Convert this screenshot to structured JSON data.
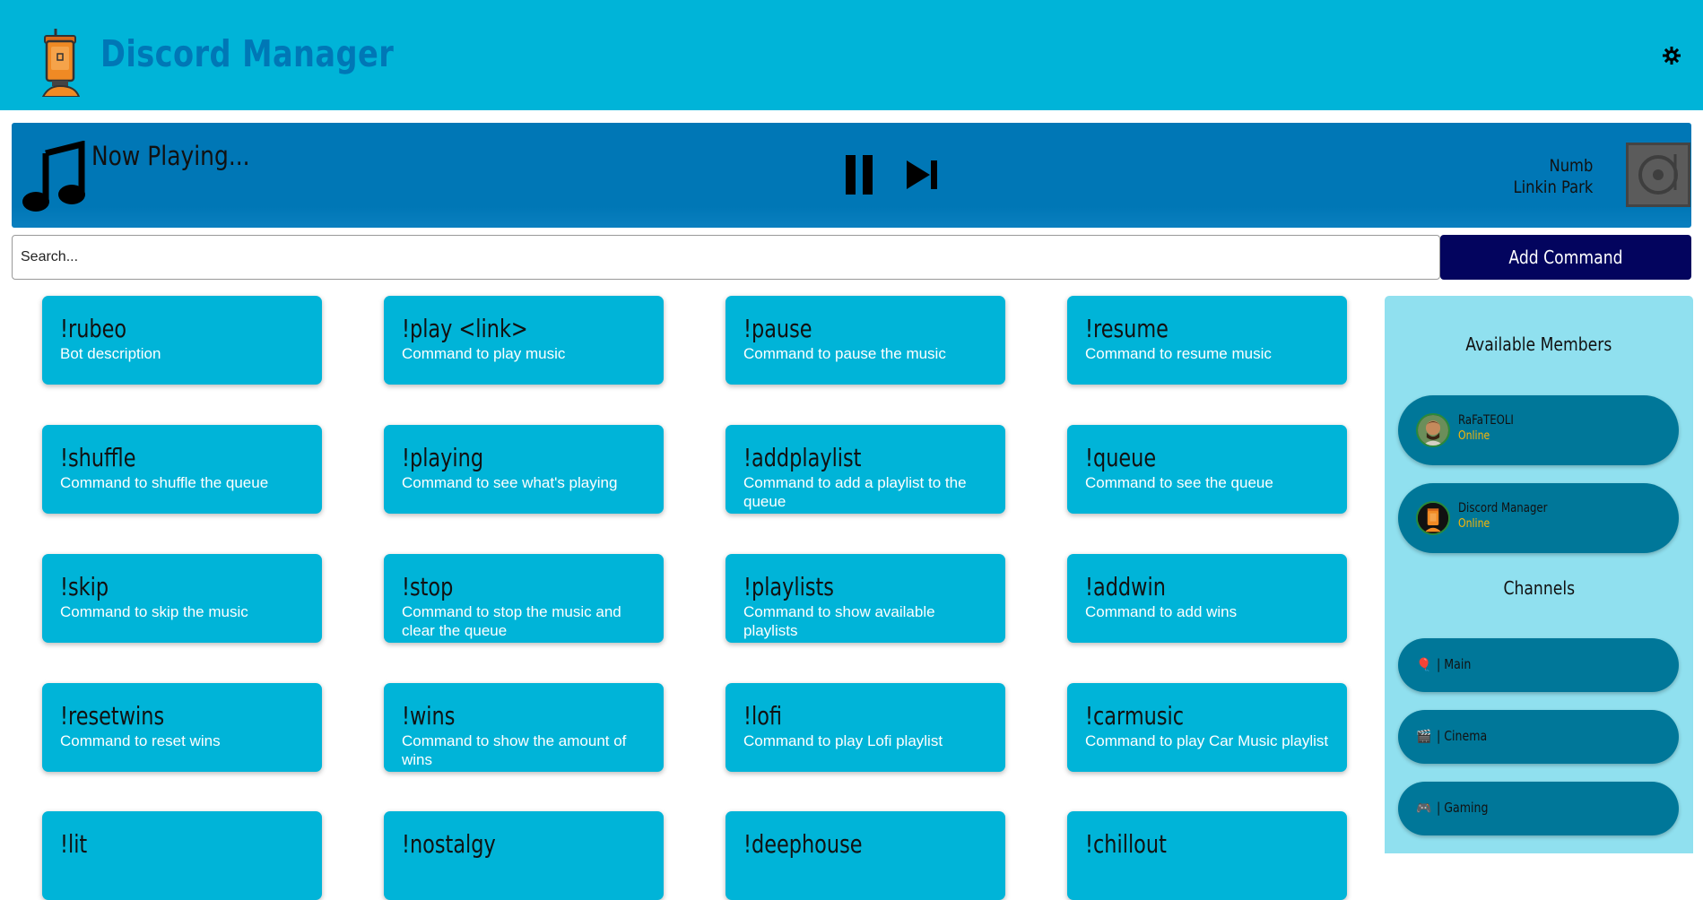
{
  "header": {
    "title": "Discord Manager",
    "logo_icon": "robot-logo-icon",
    "theme_icon": "gear-icon"
  },
  "player": {
    "status": "Now Playing...",
    "track": "Numb",
    "artist": "Linkin Park"
  },
  "search": {
    "placeholder": "Search..."
  },
  "toolbar": {
    "add_label": "Add Command"
  },
  "commands": [
    {
      "name": "!rubeo",
      "desc": "Bot description"
    },
    {
      "name": "!play <link>",
      "desc": "Command to play music"
    },
    {
      "name": "!pause",
      "desc": "Command to pause the music"
    },
    {
      "name": "!resume",
      "desc": "Command to resume music"
    },
    {
      "name": "!shuffle",
      "desc": "Command to shuffle the queue"
    },
    {
      "name": "!playing",
      "desc": "Command to see what's playing"
    },
    {
      "name": "!addplaylist",
      "desc": "Command to add a playlist to the queue"
    },
    {
      "name": "!queue",
      "desc": "Command to see the queue"
    },
    {
      "name": "!skip",
      "desc": "Command to skip the music"
    },
    {
      "name": "!stop",
      "desc": "Command to stop the music and clear the queue"
    },
    {
      "name": "!playlists",
      "desc": "Command to show available playlists"
    },
    {
      "name": "!addwin",
      "desc": "Command to add wins"
    },
    {
      "name": "!resetwins",
      "desc": "Command to reset wins"
    },
    {
      "name": "!wins",
      "desc": "Command to show the amount of wins"
    },
    {
      "name": "!lofi",
      "desc": "Command to play Lofi playlist"
    },
    {
      "name": "!carmusic",
      "desc": "Command to play Car Music playlist"
    },
    {
      "name": "!lit",
      "desc": ""
    },
    {
      "name": "!nostalgy",
      "desc": ""
    },
    {
      "name": "!deephouse",
      "desc": ""
    },
    {
      "name": "!chillout",
      "desc": ""
    }
  ],
  "sidebar": {
    "members_heading": "Available Members",
    "members": [
      {
        "name": "RaFaTEOLI",
        "status": "Online"
      },
      {
        "name": "Discord Manager",
        "status": "Online"
      }
    ],
    "channels_heading": "Channels",
    "channels": [
      {
        "icon": "🎈",
        "label": "| Main"
      },
      {
        "icon": "🎬",
        "label": "| Cinema"
      },
      {
        "icon": "🎮",
        "label": "| Gaming"
      }
    ]
  }
}
